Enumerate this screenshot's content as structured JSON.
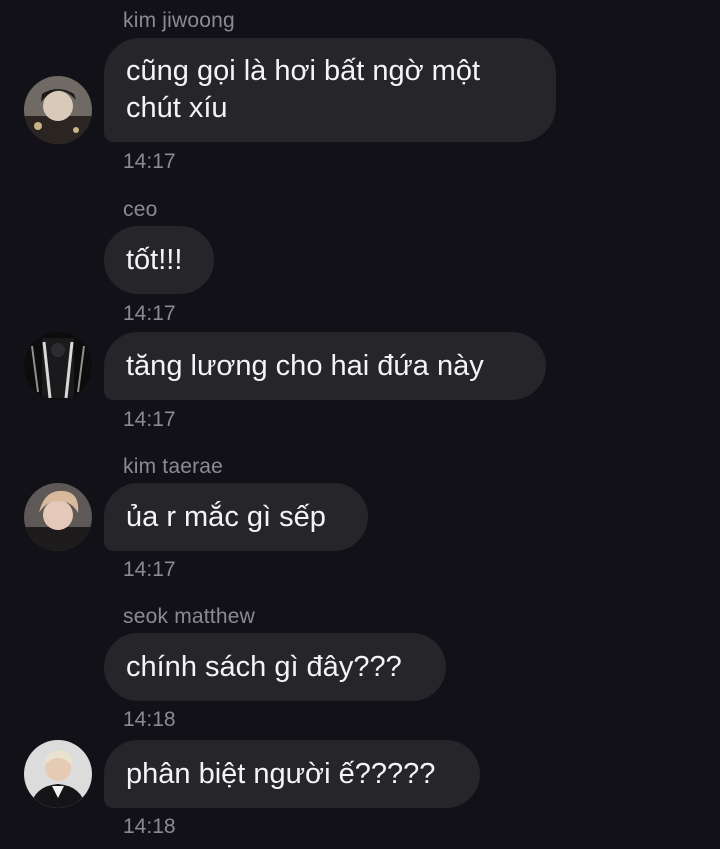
{
  "messages": [
    {
      "sender": "kim jiwoong",
      "text": "cũng gọi là hơi bất ngờ một chút xíu",
      "time": "14:17",
      "avatar": "avatar-kim-jiwoong"
    },
    {
      "sender": "ceo",
      "text": "tốt!!!",
      "time": "14:17",
      "avatar": ""
    },
    {
      "sender": "",
      "text": "tăng lương cho hai đứa này",
      "time": "14:17",
      "avatar": "avatar-ceo"
    },
    {
      "sender": "kim taerae",
      "text": "ủa r mắc gì sếp",
      "time": "14:17",
      "avatar": "avatar-kim-taerae"
    },
    {
      "sender": "seok matthew",
      "text": "chính sách gì đây???",
      "time": "14:18",
      "avatar": ""
    },
    {
      "sender": "",
      "text": "phân biệt người ế?????",
      "time": "14:18",
      "avatar": "avatar-seok-matthew"
    }
  ],
  "colors": {
    "background": "#131118",
    "bubble": "#262529",
    "meta_text": "#8b8a92",
    "message_text": "#f4f4f6"
  }
}
